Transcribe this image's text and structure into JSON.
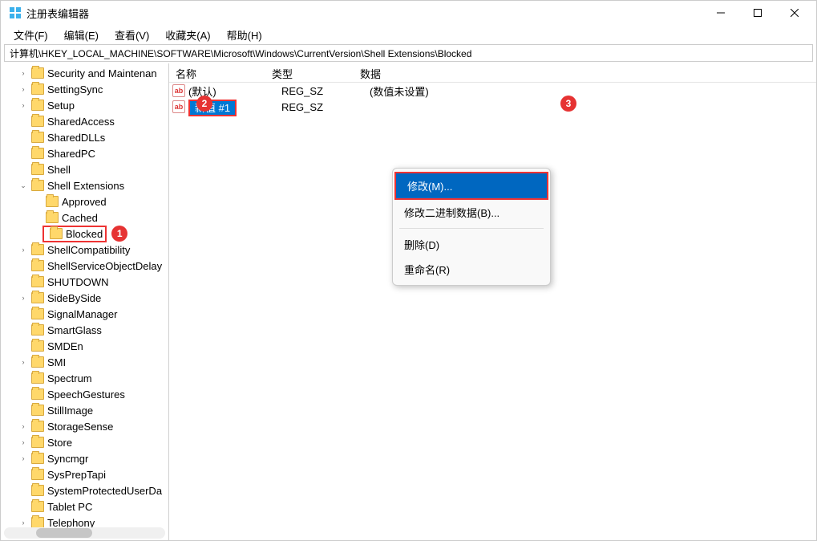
{
  "window": {
    "title": "注册表编辑器"
  },
  "menu": {
    "file": "文件(F)",
    "edit": "编辑(E)",
    "view": "查看(V)",
    "favorites": "收藏夹(A)",
    "help": "帮助(H)"
  },
  "address": "计算机\\HKEY_LOCAL_MACHINE\\SOFTWARE\\Microsoft\\Windows\\CurrentVersion\\Shell Extensions\\Blocked",
  "tree": [
    {
      "indent": 1,
      "exp": "right",
      "label": "Security and Maintenan"
    },
    {
      "indent": 1,
      "exp": "right",
      "label": "SettingSync"
    },
    {
      "indent": 1,
      "exp": "right",
      "label": "Setup"
    },
    {
      "indent": 1,
      "exp": "none",
      "label": "SharedAccess"
    },
    {
      "indent": 1,
      "exp": "none",
      "label": "SharedDLLs"
    },
    {
      "indent": 1,
      "exp": "none",
      "label": "SharedPC"
    },
    {
      "indent": 1,
      "exp": "none",
      "label": "Shell"
    },
    {
      "indent": 1,
      "exp": "down",
      "label": "Shell Extensions"
    },
    {
      "indent": 2,
      "exp": "none",
      "label": "Approved"
    },
    {
      "indent": 2,
      "exp": "none",
      "label": "Cached"
    },
    {
      "indent": 2,
      "exp": "none",
      "label": "Blocked",
      "selected": true,
      "badge": "1"
    },
    {
      "indent": 1,
      "exp": "right",
      "label": "ShellCompatibility"
    },
    {
      "indent": 1,
      "exp": "none",
      "label": "ShellServiceObjectDelay"
    },
    {
      "indent": 1,
      "exp": "none",
      "label": "SHUTDOWN"
    },
    {
      "indent": 1,
      "exp": "right",
      "label": "SideBySide"
    },
    {
      "indent": 1,
      "exp": "none",
      "label": "SignalManager"
    },
    {
      "indent": 1,
      "exp": "none",
      "label": "SmartGlass"
    },
    {
      "indent": 1,
      "exp": "none",
      "label": "SMDEn"
    },
    {
      "indent": 1,
      "exp": "right",
      "label": "SMI"
    },
    {
      "indent": 1,
      "exp": "none",
      "label": "Spectrum"
    },
    {
      "indent": 1,
      "exp": "none",
      "label": "SpeechGestures"
    },
    {
      "indent": 1,
      "exp": "none",
      "label": "StillImage"
    },
    {
      "indent": 1,
      "exp": "right",
      "label": "StorageSense"
    },
    {
      "indent": 1,
      "exp": "right",
      "label": "Store"
    },
    {
      "indent": 1,
      "exp": "right",
      "label": "Syncmgr"
    },
    {
      "indent": 1,
      "exp": "none",
      "label": "SysPrepTapi"
    },
    {
      "indent": 1,
      "exp": "none",
      "label": "SystemProtectedUserDa"
    },
    {
      "indent": 1,
      "exp": "none",
      "label": "Tablet PC"
    },
    {
      "indent": 1,
      "exp": "right",
      "label": "Telephony"
    }
  ],
  "columns": {
    "name": "名称",
    "type": "类型",
    "data": "数据"
  },
  "rows": [
    {
      "iconText": "ab",
      "name": "(默认)",
      "type": "REG_SZ",
      "data": "(数值未设置)"
    },
    {
      "iconText": "ab",
      "name": "新值 #1",
      "type": "REG_SZ",
      "data": "",
      "highlighted": true,
      "badge": "2"
    }
  ],
  "contextMenu": {
    "modify": "修改(M)...",
    "modifyBinary": "修改二进制数据(B)...",
    "delete": "删除(D)",
    "rename": "重命名(R)",
    "badge": "3"
  }
}
